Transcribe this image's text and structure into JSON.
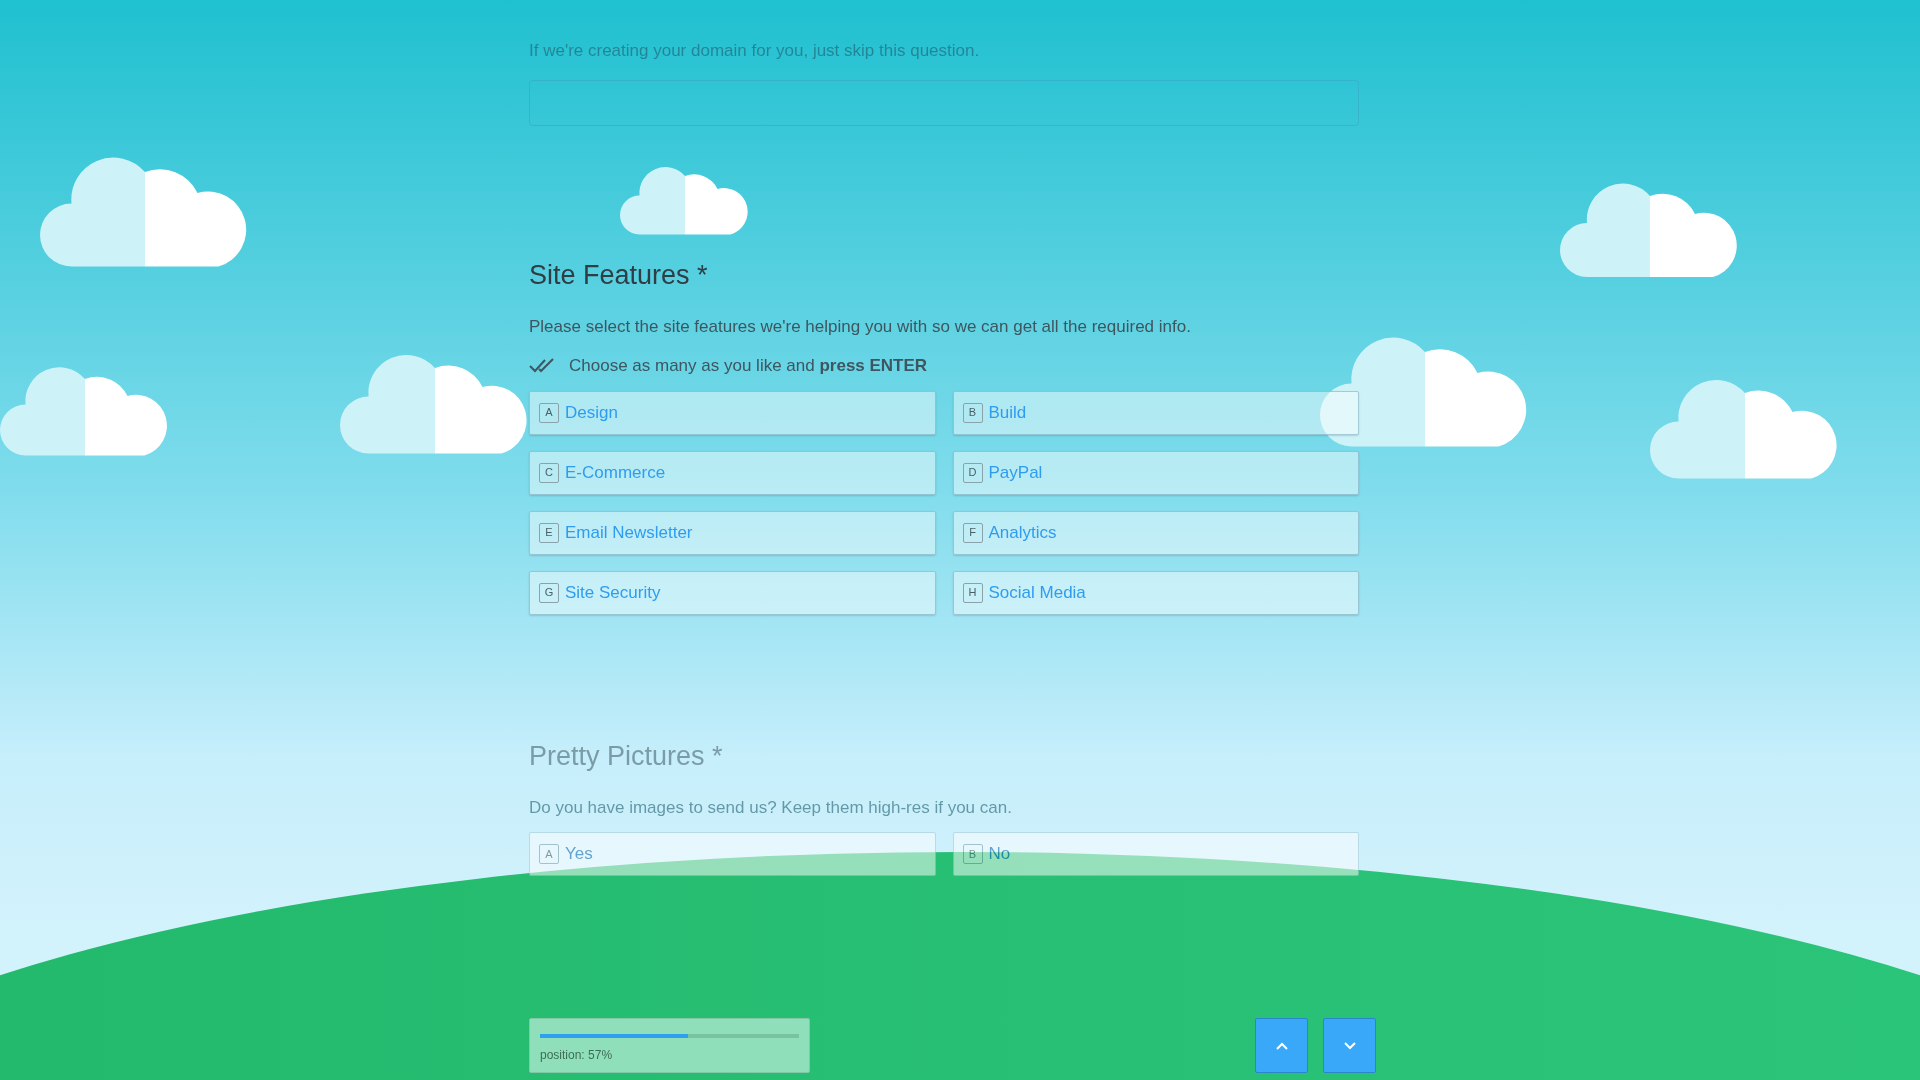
{
  "questions": [
    {
      "active": false,
      "description": "If we're creating your domain for you, just skip this question.",
      "kind": "text"
    },
    {
      "title": "Site Features *",
      "active": true,
      "description": "Please select the site features we're helping you with so we can get all the required info.",
      "kind": "multi",
      "hint": "Choose as many as you like and **press ENTER**",
      "choices": [
        {
          "key": "A",
          "label": "Design",
          "selected": false
        },
        {
          "key": "B",
          "label": "Build",
          "selected": false
        },
        {
          "key": "C",
          "label": "E-Commerce",
          "selected": false
        },
        {
          "key": "D",
          "label": "PayPal",
          "selected": false
        },
        {
          "key": "E",
          "label": "Email Newsletter",
          "selected": false
        },
        {
          "key": "F",
          "label": "Analytics",
          "selected": false
        },
        {
          "key": "G",
          "label": "Site Security",
          "selected": false
        },
        {
          "key": "H",
          "label": "Social Media",
          "selected": false
        }
      ]
    },
    {
      "title": "Pretty Pictures *",
      "active": false,
      "description": "Do you have images to send us? Keep them high-res if you can.",
      "kind": "single",
      "choices": [
        {
          "key": "A",
          "label": "Yes",
          "selected": false
        },
        {
          "key": "B",
          "label": "No",
          "selected": false
        }
      ]
    }
  ],
  "progress": {
    "level": 0.57,
    "label": "position: 57%"
  }
}
